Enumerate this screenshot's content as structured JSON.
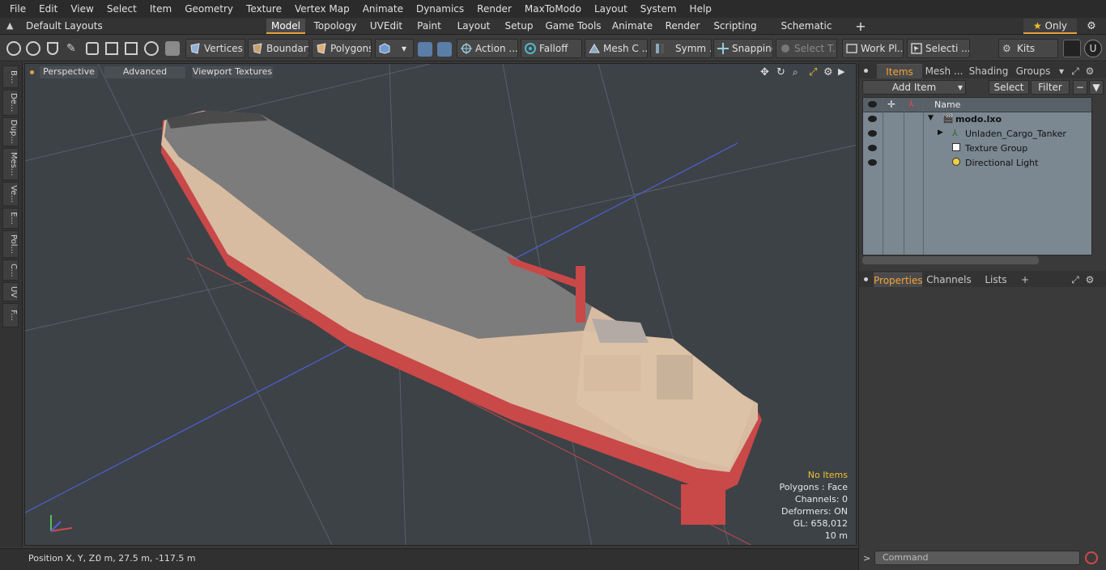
{
  "menubar": {
    "items": [
      "File",
      "Edit",
      "View",
      "Select",
      "Item",
      "Geometry",
      "Texture",
      "Vertex Map",
      "Animate",
      "Dynamics",
      "Render",
      "MaxToModo",
      "Layout",
      "System",
      "Help"
    ]
  },
  "layoutbar": {
    "layout_menu": "Default Layouts ▾",
    "tabs": [
      "Model",
      "Topology",
      "UVEdit",
      "Paint",
      "Layout",
      "Setup",
      "Game Tools",
      "Animate",
      "Render",
      "Scripting",
      "Schematic Fusion"
    ],
    "active_tab": "Model",
    "only_label": "Only"
  },
  "toolbar": {
    "vertices": "Vertices",
    "boundary": "Boundary",
    "polygons": "Polygons",
    "action": "Action ...",
    "falloff": "Falloff",
    "mesh": "Mesh C ...",
    "symm": "Symm ...",
    "snapping": "Snapping",
    "select_t": "Select T...",
    "work_pl": "Work Pl...",
    "selecti": "Selecti ...",
    "kits": "Kits"
  },
  "lefttabs": [
    "B...",
    "De...",
    "Dup...",
    "Mes...",
    "Ve...",
    "E...",
    "Pol...",
    "C...",
    "UV",
    "F..."
  ],
  "viewport": {
    "perspective": "Perspective",
    "advanced": "Advanced",
    "viewport_textures": "Viewport Textures",
    "info": {
      "no_items": "No Items",
      "polygons": "Polygons : Face",
      "channels": "Channels: 0",
      "deformers": "Deformers: ON",
      "gl": "GL: 658,012",
      "scale": "10 m"
    }
  },
  "status": {
    "label": "Position X, Y, Z:",
    "value": "0 m, 27.5 m, -117.5 m"
  },
  "items_panel": {
    "tabs": [
      "Items",
      "Mesh ...",
      "Shading",
      "Groups"
    ],
    "active_tab": "Items",
    "add_item": "Add Item",
    "select": "Select",
    "filter": "Filter",
    "col_name": "Name",
    "rows": [
      {
        "label": "modo.lxo"
      },
      {
        "label": "Unladen_Cargo_Tanker"
      },
      {
        "label": "Texture Group"
      },
      {
        "label": "Directional Light"
      }
    ]
  },
  "props_panel": {
    "tabs": [
      "Properties",
      "Channels",
      "Lists"
    ],
    "active_tab": "Properties"
  },
  "command": {
    "placeholder": "Command"
  },
  "colors": {
    "accent": "#e6a23c",
    "highlight": "#f0c02a",
    "hull_red": "#c94848",
    "hull_cream": "#d8bca2"
  }
}
